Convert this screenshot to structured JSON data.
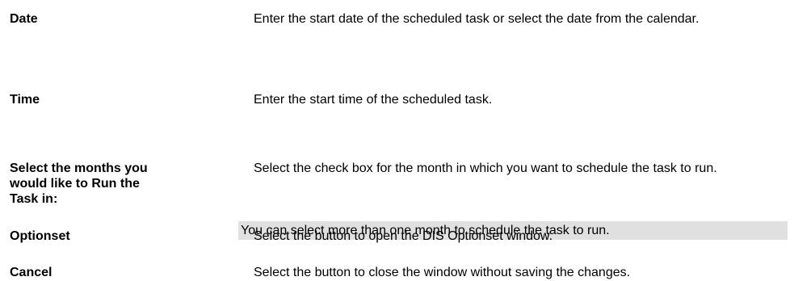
{
  "rows": [
    {
      "term": "Date",
      "description": "Enter the start date of the scheduled task or select the date from the calendar."
    },
    {
      "term": "Time",
      "description": "Enter the start time of the scheduled task."
    },
    {
      "term": "Select the months you would like to Run the Task in:",
      "description": "Select the check box for the month in which you want to schedule the task to run."
    },
    {
      "term": "Optionset",
      "description": "Select the button to open the DIS Optionset window."
    },
    {
      "term": "Cancel",
      "description": "Select the button to close the window without saving the changes."
    }
  ],
  "note": "You can select more than one month to schedule the task to run.",
  "colors": {
    "note_background": "#e0e0e0",
    "text": "#000000"
  }
}
